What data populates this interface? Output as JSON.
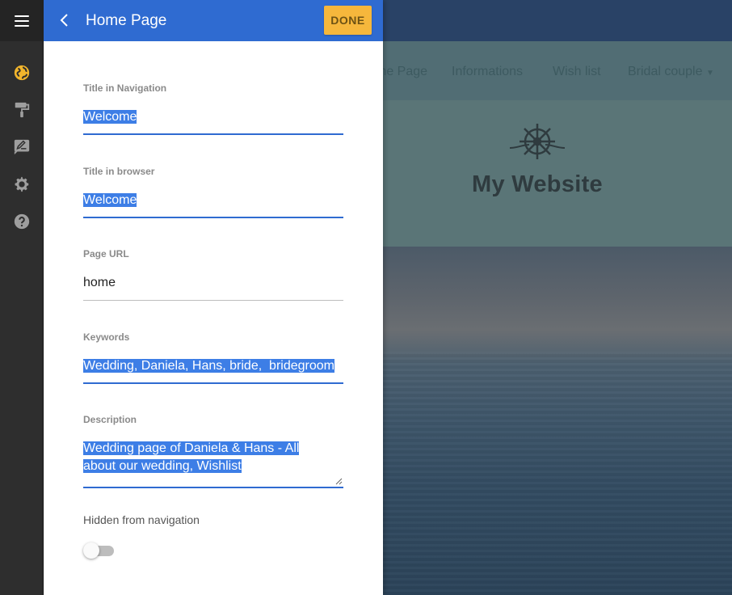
{
  "colors": {
    "panel_header": "#2f6bd1",
    "done_button": "#f6b73c",
    "active_tool": "#f2b52c",
    "selection": "#3d7ee6"
  },
  "toolbar": {
    "menu_icon": "hamburger-icon",
    "tools": [
      {
        "icon": "globe-icon",
        "active": true
      },
      {
        "icon": "paint-roller-icon",
        "active": false
      },
      {
        "icon": "edit-text-icon",
        "active": false
      },
      {
        "icon": "gear-icon",
        "active": false
      },
      {
        "icon": "help-icon",
        "active": false
      }
    ]
  },
  "panel": {
    "title": "Home Page",
    "done_label": "DONE",
    "fields": {
      "nav_title": {
        "label": "Title in Navigation",
        "value": "Welcome"
      },
      "browser_title": {
        "label": "Title in browser",
        "value": "Welcome"
      },
      "page_url": {
        "label": "Page URL",
        "value": "home"
      },
      "keywords": {
        "label": "Keywords",
        "value": "Wedding, Daniela, Hans, bride,  bridegroom"
      },
      "description": {
        "label": "Description",
        "line1": "Wedding page of Daniela & Hans - All",
        "line2": "about our wedding, Wishlist"
      }
    },
    "hidden_label": "Hidden from navigation",
    "hidden_value": false
  },
  "preview": {
    "nav": [
      "me Page",
      "Informations",
      "Wish list",
      "Bridal couple"
    ],
    "site_title": "My Website"
  }
}
